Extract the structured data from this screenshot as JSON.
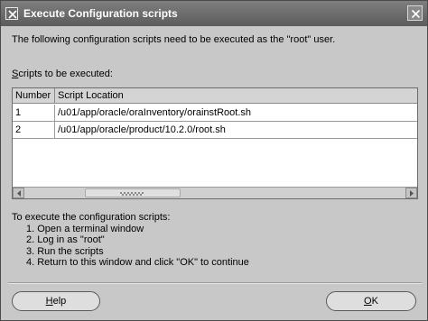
{
  "window": {
    "title": "Execute Configuration scripts"
  },
  "intro_text": "The following configuration scripts need to be executed as the \"root\" user.",
  "scripts_label": {
    "mnemonic": "S",
    "rest": "cripts to be executed:"
  },
  "table": {
    "columns": [
      "Number",
      "Script Location"
    ],
    "rows": [
      {
        "number": "1",
        "location": "/u01/app/oracle/oraInventory/orainstRoot.sh"
      },
      {
        "number": "2",
        "location": "/u01/app/oracle/product/10.2.0/root.sh"
      }
    ]
  },
  "instructions": {
    "heading": "To execute the configuration scripts:",
    "steps": [
      "1. Open a terminal window",
      "2. Log in as \"root\"",
      "3. Run the scripts",
      "4. Return to this window and click \"OK\" to continue"
    ]
  },
  "buttons": {
    "help": {
      "mnemonic": "H",
      "rest": "elp"
    },
    "ok": {
      "mnemonic": "O",
      "rest": "K"
    }
  },
  "icons": {
    "title_icon": "close-x-icon",
    "close": "close-icon",
    "scroll_left": "arrow-left-icon",
    "scroll_right": "arrow-right-icon"
  }
}
